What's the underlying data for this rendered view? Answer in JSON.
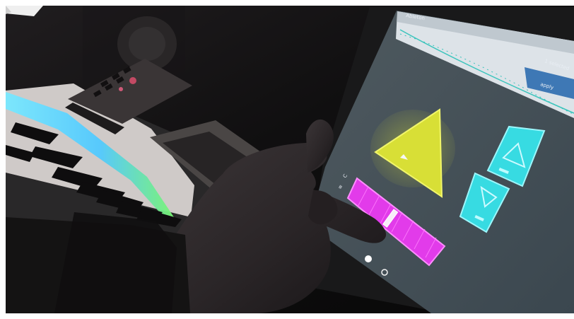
{
  "tablet": {
    "top_left_label": "Ableton",
    "top_right_label": "1 selected",
    "side_button_label": "apply"
  },
  "colors": {
    "yellow": "#d9dd2f",
    "cyan": "#38d6df",
    "magenta": "#e238ea",
    "keyboard_glow": "#6cf0ff",
    "screen_bg": "#435059"
  }
}
